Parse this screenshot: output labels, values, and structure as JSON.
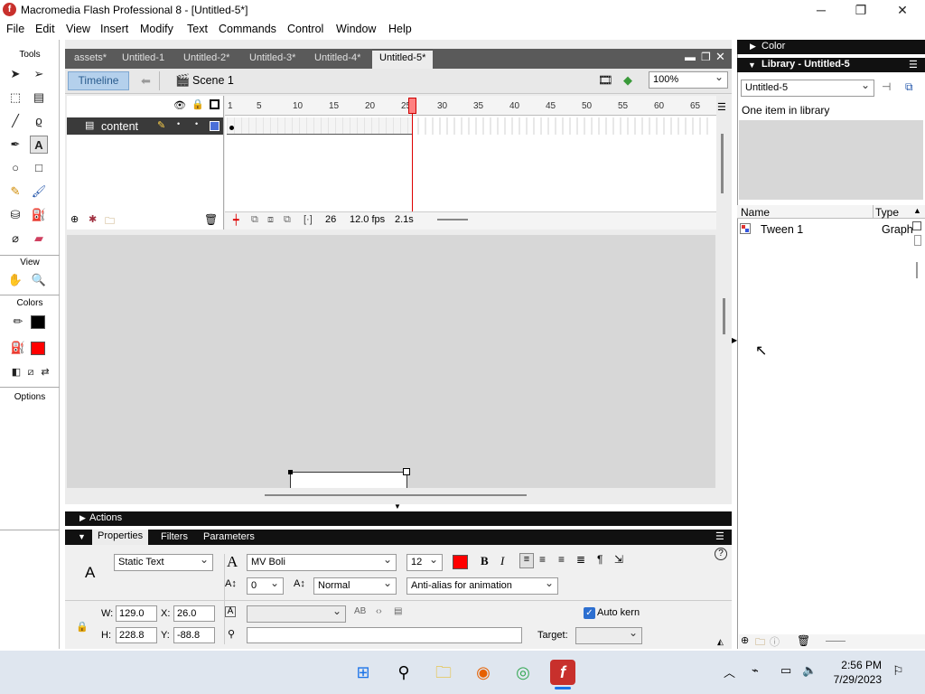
{
  "window": {
    "title": "Macromedia Flash Professional 8 - [Untitled-5*]",
    "minimize": "─",
    "maximize": "❐",
    "close": "✕"
  },
  "menu": [
    "File",
    "Edit",
    "View",
    "Insert",
    "Modify",
    "Text",
    "Commands",
    "Control",
    "Window",
    "Help"
  ],
  "toolbox": {
    "tools_label": "Tools",
    "view_label": "View",
    "colors_label": "Colors",
    "options_label": "Options",
    "stroke_color": "#000000",
    "fill_color": "#ff0000"
  },
  "doc_tabs": [
    "assets*",
    "Untitled-1",
    "Untitled-2*",
    "Untitled-3*",
    "Untitled-4*",
    "Untitled-5*"
  ],
  "timeline": {
    "timeline_label": "Timeline",
    "scene_label": "Scene 1",
    "zoom": "100%",
    "layer_name": "content",
    "ruler_numbers": [
      "1",
      "5",
      "10",
      "15",
      "20",
      "25",
      "30",
      "35",
      "40",
      "45",
      "50",
      "55",
      "60",
      "65"
    ],
    "current_frame": "26",
    "fps": "12.0 fps",
    "time": "2.1s"
  },
  "actions_label": "Actions",
  "properties": {
    "tabs": [
      "Properties",
      "Filters",
      "Parameters"
    ],
    "text_type": "Static Text",
    "font": "MV Boli",
    "font_size": "12",
    "text_color": "#ff0000",
    "letter_spacing": "0",
    "baseline": "Normal",
    "antialias": "Anti-alias for animation",
    "auto_kern": "Auto kern",
    "w_label": "W:",
    "w": "129.0",
    "x_label": "X:",
    "x": "26.0",
    "h_label": "H:",
    "h": "228.8",
    "y_label": "Y:",
    "y": "-88.8",
    "target_label": "Target:"
  },
  "right_panel": {
    "color_label": "Color",
    "library_label": "Library - Untitled-5",
    "library_doc": "Untitled-5",
    "item_count": "One item in library",
    "col_name": "Name",
    "col_type": "Type",
    "item_name": "Tween 1",
    "item_type": "Graph"
  },
  "taskbar": {
    "time": "2:56 PM",
    "date": "7/29/2023"
  }
}
